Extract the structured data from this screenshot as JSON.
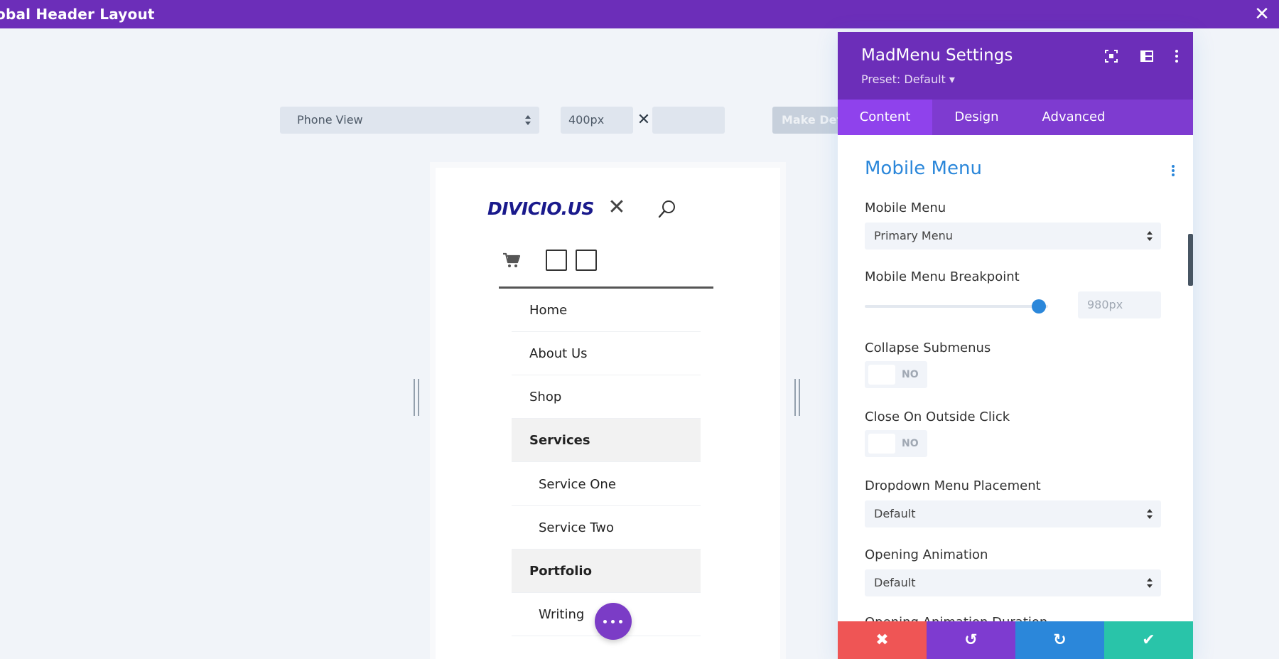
{
  "topbar": {
    "title": "obal Header Layout",
    "close_glyph": "✕"
  },
  "view_controls": {
    "view_select": "Phone View",
    "width_value": "400px",
    "times_glyph": "✕",
    "height_value": "",
    "make_default_label": "Make Defa"
  },
  "preview": {
    "logo_text": "DIVICIO.US",
    "close_glyph": "✕",
    "menu_items": [
      {
        "label": "Home"
      },
      {
        "label": "About Us"
      },
      {
        "label": "Shop"
      },
      {
        "label": "Services"
      },
      {
        "label": "Service One"
      },
      {
        "label": "Service Two"
      },
      {
        "label": "Portfolio"
      },
      {
        "label": "Writing"
      }
    ]
  },
  "panel": {
    "title": "MadMenu Settings",
    "preset": "Preset: Default ▾",
    "tabs": [
      "Content",
      "Design",
      "Advanced"
    ],
    "section_title": "Mobile Menu",
    "fields": {
      "mobile_menu_label": "Mobile Menu",
      "mobile_menu_value": "Primary Menu",
      "breakpoint_label": "Mobile Menu Breakpoint",
      "breakpoint_value": "980px",
      "breakpoint_level": 0.95,
      "collapse_label": "Collapse Submenus",
      "collapse_value": "NO",
      "close_outside_label": "Close On Outside Click",
      "close_outside_value": "NO",
      "dropdown_label": "Dropdown Menu Placement",
      "dropdown_value": "Default",
      "opening_anim_label": "Opening Animation",
      "opening_anim_value": "Default",
      "next_label_partial": "Opening Animation Duration"
    },
    "footer": {
      "cancel": "✖",
      "undo": "↺",
      "redo": "↻",
      "save": "✔"
    }
  },
  "colors": {
    "brand_purple": "#6c2eb9",
    "tab_active": "#8f42ec",
    "accent_blue": "#2b87da",
    "cancel_red": "#ef5555",
    "undo_purple": "#7e3bd0",
    "redo_blue": "#2b87da",
    "save_green": "#29c4a9"
  }
}
